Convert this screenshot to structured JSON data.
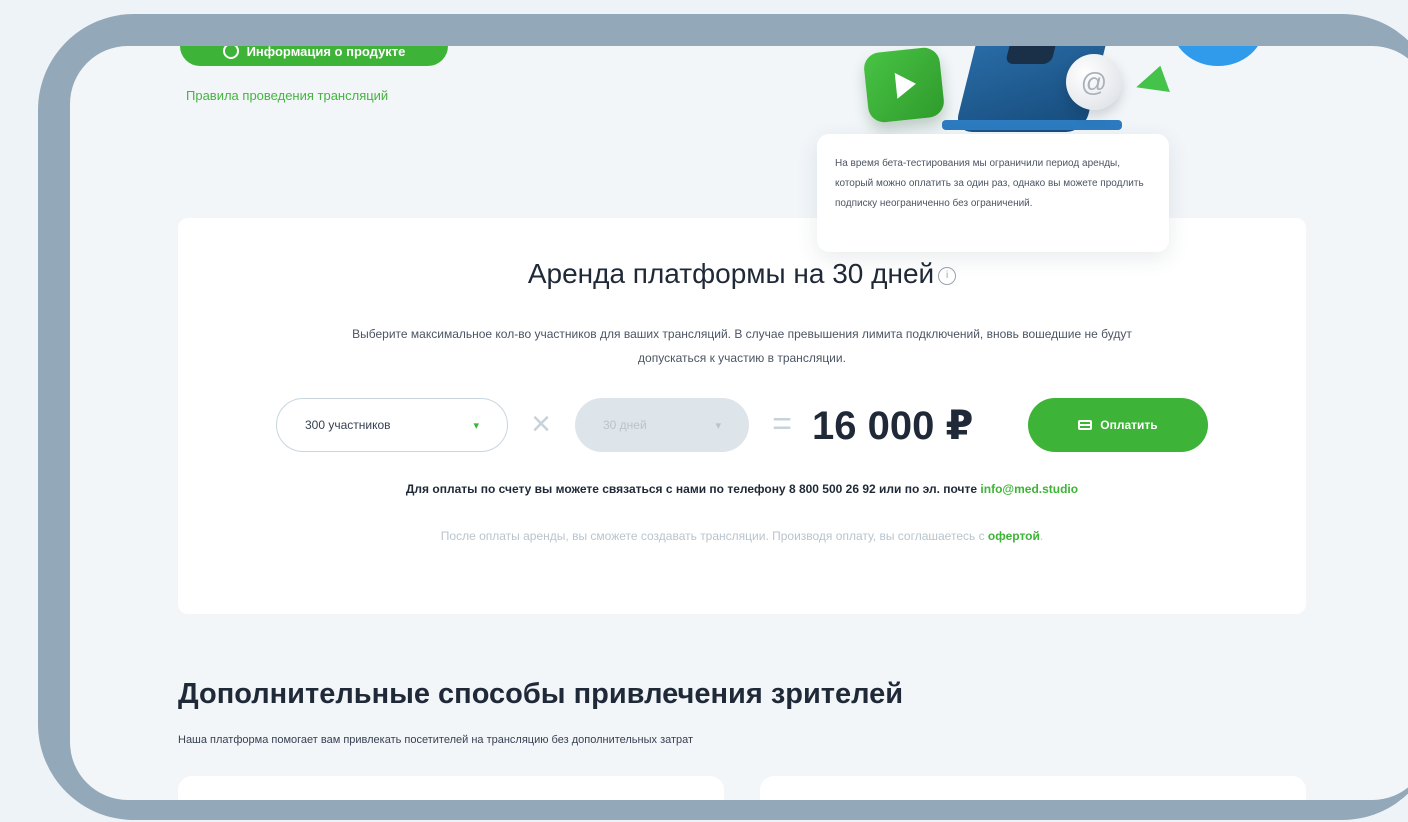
{
  "header": {
    "info_button_label": "Информация о продукте",
    "rules_link": "Правила проведения трансляций"
  },
  "tooltip": {
    "text": "На время бета-тестирования мы ограничили период аренды, который можно оплатить за один раз, однако вы можете продлить подписку неограниченно без ограничений."
  },
  "rental": {
    "title": "Аренда платформы на 30 дней",
    "description": "Выберите максимальное кол-во участников для ваших трансляций. В случае превышения лимита подключений, вновь вошедшие не будут допускаться к участию в трансляции.",
    "participants_value": "300 участников",
    "days_value": "30 дней",
    "times_sign": "×",
    "equals_sign": "=",
    "price": "16 000 ₽",
    "pay_button_label": "Оплатить",
    "contact_text": "Для оплаты по счету вы можете связаться с нами по телефону 8 800 500 26 92 или по эл. почте ",
    "contact_email": "info@med.studio",
    "after_pay_text": "После оплаты аренды, вы сможете создавать трансляции. Производя оплату, вы соглашаетесь с ",
    "offer_link": "офертой",
    "after_pay_end": "."
  },
  "section": {
    "title": "Дополнительные способы привлечения зрителей",
    "subtitle": "Наша платформа помогает вам привлекать посетителей на трансляцию без дополнительных затрат"
  },
  "colors": {
    "accent": "#3db337",
    "frame": "#93a8b8",
    "background": "#f2f6f9"
  }
}
